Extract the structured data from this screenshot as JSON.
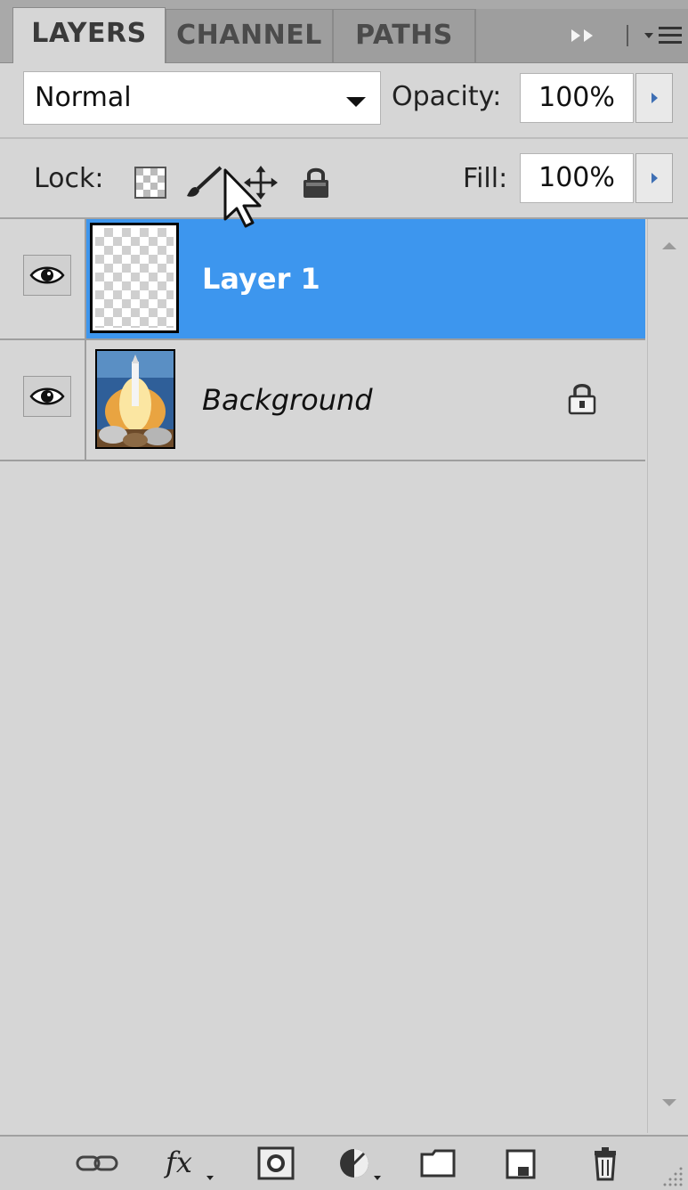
{
  "tabs": [
    {
      "label": "LAYERS",
      "active": true
    },
    {
      "label": "CHANNEL",
      "active": false
    },
    {
      "label": "PATHS",
      "active": false
    }
  ],
  "blend_mode": {
    "value": "Normal"
  },
  "opacity": {
    "label": "Opacity:",
    "value": "100%"
  },
  "lock": {
    "label": "Lock:",
    "options": [
      "lock-transparent-pixels-icon",
      "lock-image-pixels-icon",
      "lock-position-icon",
      "lock-all-icon"
    ]
  },
  "fill": {
    "label": "Fill:",
    "value": "100%"
  },
  "layers": [
    {
      "name": "Layer 1",
      "visible": true,
      "selected": true,
      "locked": false,
      "thumbnail": "transparent"
    },
    {
      "name": "Background",
      "visible": true,
      "selected": false,
      "locked": true,
      "thumbnail": "rocket-launch-photo"
    }
  ],
  "bottom_toolbar": [
    "link-layers-icon",
    "layer-style-icon",
    "add-mask-icon",
    "adjustment-layer-icon",
    "new-group-icon",
    "new-layer-icon",
    "delete-layer-icon"
  ],
  "colors": {
    "selection": "#3d96ee",
    "panel": "#d6d6d6",
    "tab_bar": "#a9a9a9",
    "stepper_arrow": "#3e6fb4"
  }
}
